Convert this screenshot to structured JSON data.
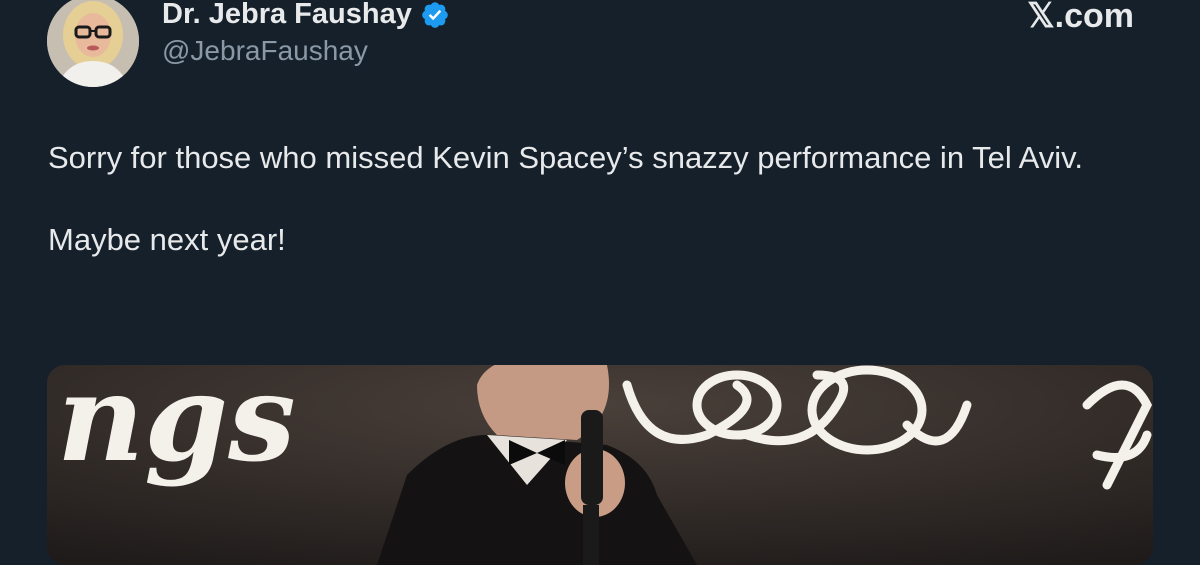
{
  "tweet": {
    "author": {
      "display_name": "Dr. Jebra Faushay",
      "handle": "@JebraFaushay",
      "verified": true,
      "verified_color": "#1d9bf0"
    },
    "site_mark": "𝕏.com",
    "text_lines": [
      "Sorry for those who missed Kevin Spacey’s snazzy performance in Tel Aviv.",
      "Maybe next year!"
    ],
    "media": {
      "type": "video-still",
      "visible_script_text": "ngs"
    }
  },
  "theme": {
    "background": "#15202b",
    "text": "#e7e9ea",
    "muted": "#8b98a5"
  }
}
